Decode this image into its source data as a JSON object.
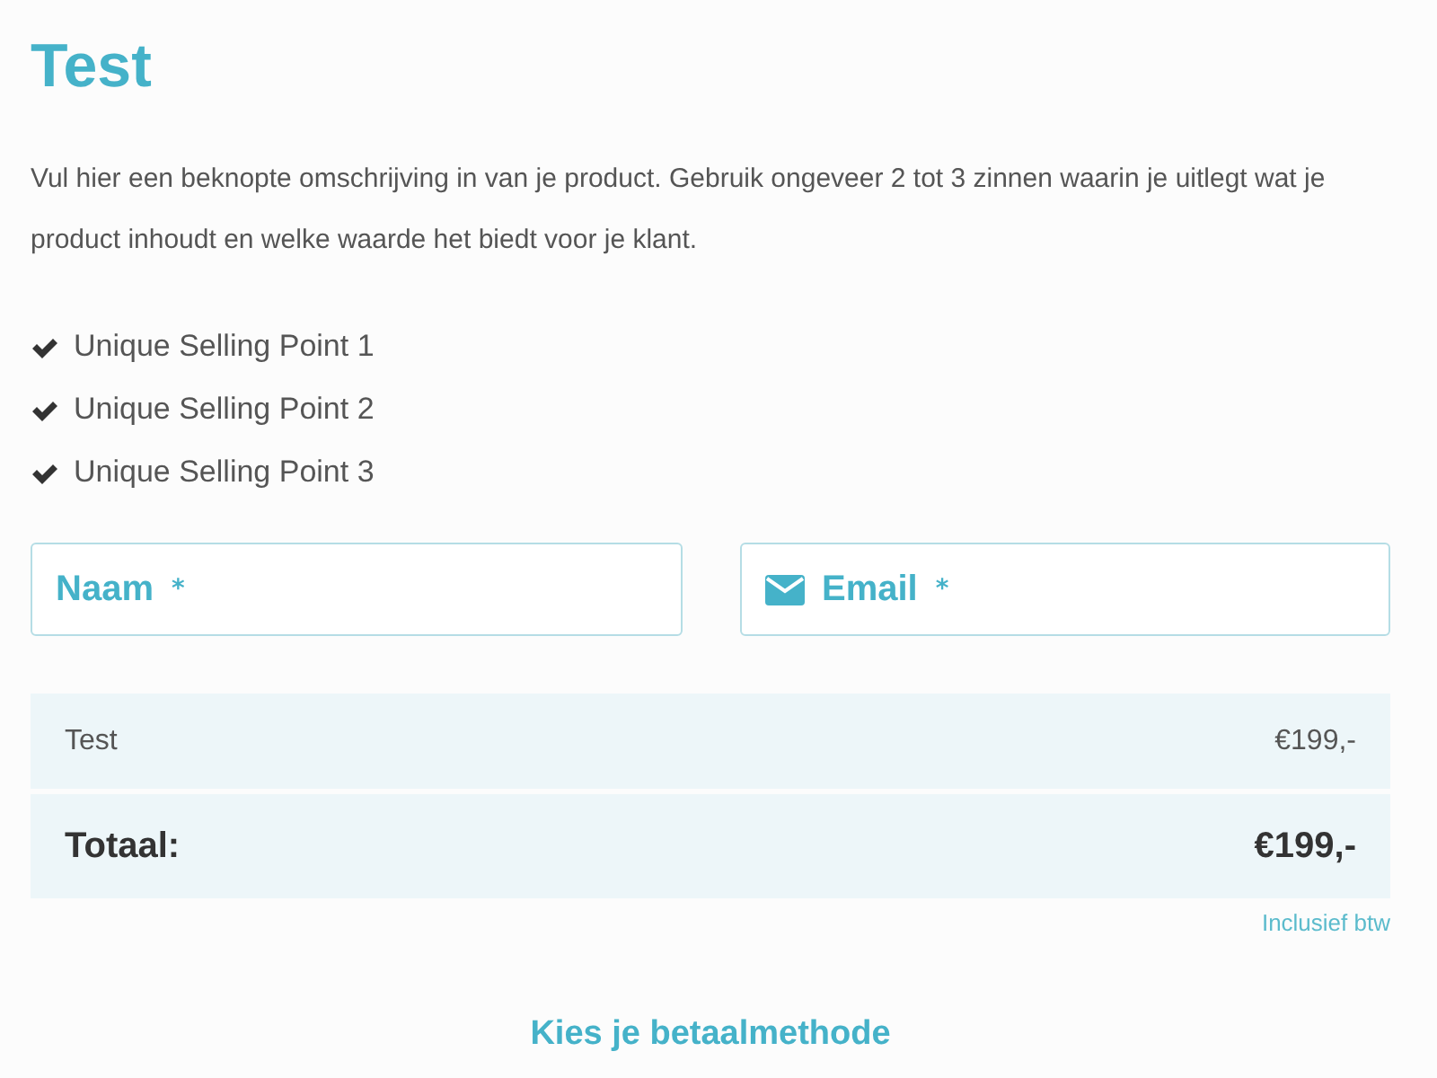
{
  "product": {
    "title": "Test",
    "description": "Vul hier een beknopte omschrijving in van je product. Gebruik ongeveer 2 tot 3 zinnen waarin je uitlegt wat je product inhoudt en welke waarde het biedt voor je klant."
  },
  "usps": [
    "Unique Selling Point 1",
    "Unique Selling Point 2",
    "Unique Selling Point 3"
  ],
  "fields": [
    {
      "kind": "text",
      "label": "Naam",
      "required_mark": "*"
    },
    {
      "kind": "email",
      "label": "Email",
      "required_mark": "*"
    }
  ],
  "summary": {
    "rows": [
      {
        "kind": "item",
        "label": "Test",
        "price": "€199,-"
      },
      {
        "kind": "total",
        "label": "Totaal:",
        "price": "€199,-"
      }
    ],
    "note": "Inclusief btw"
  },
  "payment_heading": "Kies je betaalmethode"
}
